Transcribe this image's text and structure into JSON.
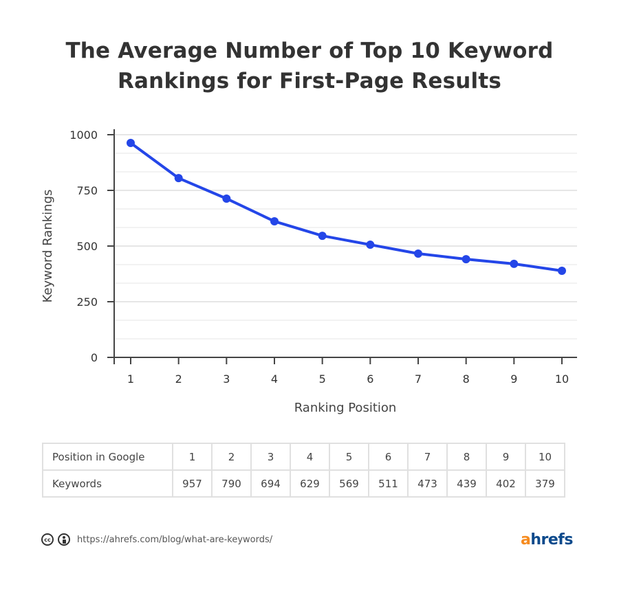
{
  "title": {
    "line1": "The Average Number of Top 10 Keyword",
    "line2": "Rankings for First-Page Results"
  },
  "chart_data": {
    "type": "line",
    "title": "The Average Number of Top 10 Keyword Rankings for First-Page Results",
    "xlabel": "Ranking Position",
    "ylabel": "Keyword Rankings",
    "x": [
      1,
      2,
      3,
      4,
      5,
      6,
      7,
      8,
      9,
      10
    ],
    "series": [
      {
        "name": "Keyword Rankings",
        "color": "#2446e8",
        "values": [
          963,
          805,
          713,
          611,
          546,
          506,
          466,
          441,
          420,
          389
        ]
      }
    ],
    "ylim": [
      0,
      1000
    ],
    "yticks": [
      0,
      250,
      500,
      750,
      1000
    ],
    "yminor_step": 83.33,
    "xticks": [
      1,
      2,
      3,
      4,
      5,
      6,
      7,
      8,
      9,
      10
    ],
    "grid": true,
    "legend": "none"
  },
  "table": {
    "rows": [
      {
        "label": "Position in  Google",
        "cells": [
          "1",
          "2",
          "3",
          "4",
          "5",
          "6",
          "7",
          "8",
          "9",
          "10"
        ]
      },
      {
        "label": "Keywords",
        "cells": [
          "957",
          "790",
          "694",
          "629",
          "569",
          "511",
          "473",
          "439",
          "402",
          "379"
        ]
      }
    ]
  },
  "footer": {
    "license_icons": [
      "cc-icon",
      "attribution-icon"
    ],
    "cc_text": "cc",
    "source_url": "https://ahrefs.com/blog/what-are-keywords/",
    "logo_a": "a",
    "logo_rest": "hrefs"
  },
  "colors": {
    "line": "#2446e8",
    "axis": "#444444",
    "grid_major": "#e6e6e6",
    "grid_minor": "#f2f2f2",
    "logo_orange": "#f68b1f",
    "logo_blue": "#0c4a8c"
  }
}
